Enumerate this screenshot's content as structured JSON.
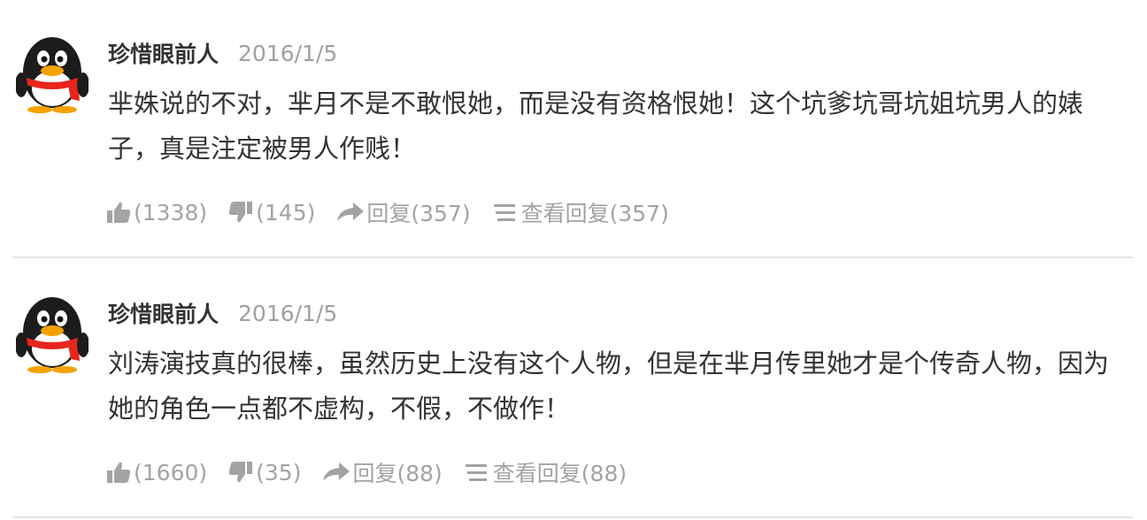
{
  "comments": [
    {
      "username": "珍惜眼前人",
      "date": "2016/1/5",
      "text": "芈姝说的不对，芈月不是不敢恨她，而是没有资格恨她！这个坑爹坑哥坑姐坑男人的婊子，真是注定被男人作贱！",
      "likes": "(1338)",
      "dislikes": "(145)",
      "reply": "回复(357)",
      "view_replies": "查看回复(357)"
    },
    {
      "username": "珍惜眼前人",
      "date": "2016/1/5",
      "text": "刘涛演技真的很棒，虽然历史上没有这个人物，但是在芈月传里她才是个传奇人物，因为她的角色一点都不虚构，不假，不做作！",
      "likes": "(1660)",
      "dislikes": "(35)",
      "reply": "回复(88)",
      "view_replies": "查看回复(88)"
    }
  ],
  "icons": {
    "avatar": "qq-penguin-avatar-icon",
    "like": "thumbs-up-icon",
    "dislike": "thumbs-down-icon",
    "reply": "share-arrow-icon",
    "view_replies": "list-lines-icon"
  },
  "colors": {
    "text": "#333333",
    "muted": "#a3a3a3",
    "divider": "#e5e5e5",
    "scarf": "#e8251d",
    "beak": "#f5a100"
  }
}
